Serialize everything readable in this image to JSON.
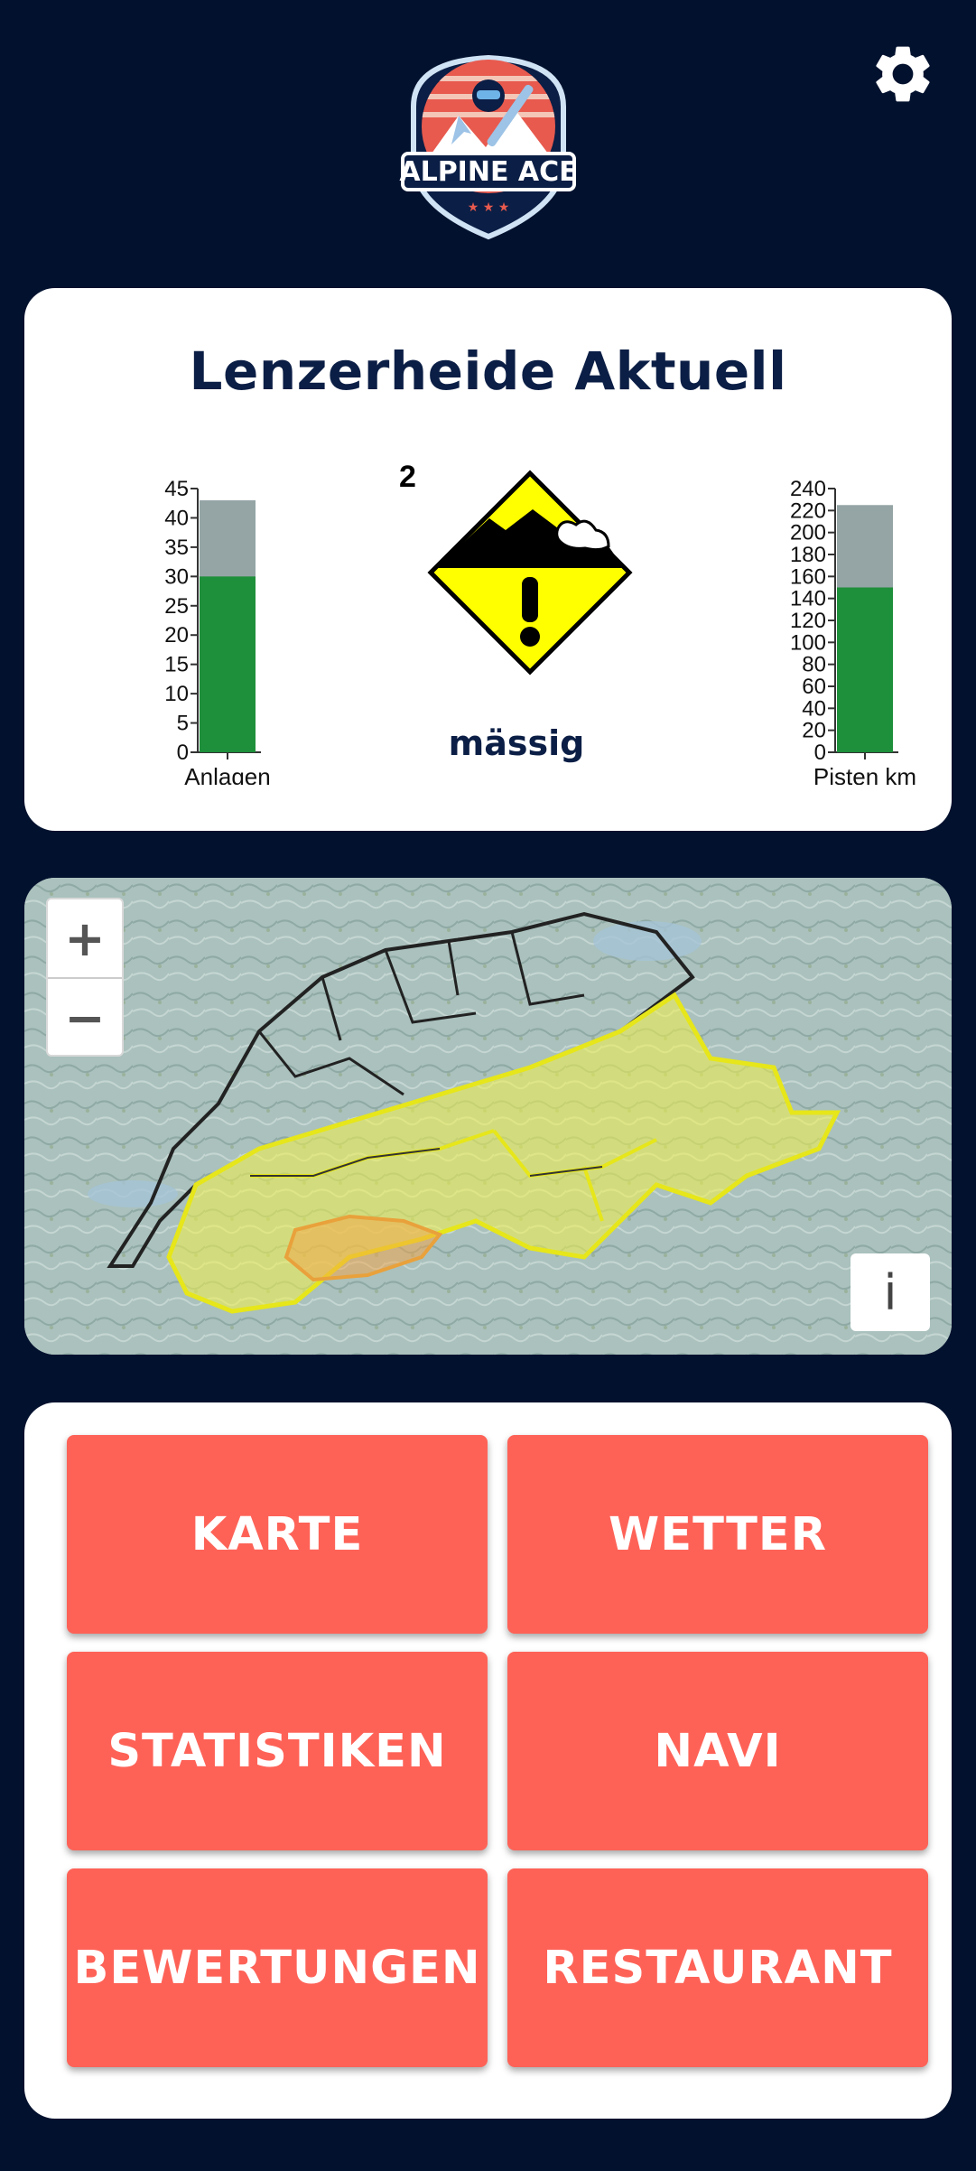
{
  "app": {
    "logo_text": "ALPINE ACE"
  },
  "header": {
    "settings_icon": "gear-icon"
  },
  "stats": {
    "title": "Lenzerheide Aktuell",
    "danger": {
      "level": "2",
      "label": "mässig",
      "icon": "avalanche-warning-icon"
    }
  },
  "chart_data": [
    {
      "type": "bar",
      "categories": [
        "Anlagen"
      ],
      "series": [
        {
          "values": [
            43
          ]
        },
        {
          "values": [
            30
          ]
        }
      ],
      "xlabel": "Anlagen",
      "ylim": [
        0,
        45
      ],
      "yticks": [
        0,
        5,
        10,
        15,
        20,
        25,
        30,
        35,
        40,
        45
      ],
      "colors": [
        "#95a5a6",
        "#1e8f3a"
      ]
    },
    {
      "type": "bar",
      "categories": [
        "Pisten km"
      ],
      "series": [
        {
          "values": [
            225
          ]
        },
        {
          "values": [
            150
          ]
        }
      ],
      "xlabel": "Pisten km",
      "ylim": [
        0,
        240
      ],
      "yticks": [
        0,
        20,
        40,
        60,
        80,
        100,
        120,
        140,
        160,
        180,
        200,
        220,
        240
      ],
      "colors": [
        "#95a5a6",
        "#1e8f3a"
      ]
    }
  ],
  "map": {
    "zoom_in": "+",
    "zoom_out": "−",
    "info": "i"
  },
  "menu": {
    "items": [
      {
        "label": "KARTE"
      },
      {
        "label": "WETTER"
      },
      {
        "label": "STATISTIKEN"
      },
      {
        "label": "NAVI"
      },
      {
        "label": "BEWERTUNGEN"
      },
      {
        "label": "RESTAURANT"
      }
    ]
  },
  "colors": {
    "background": "#02112e",
    "button": "#fe6257",
    "bar_open": "#1e8f3a",
    "bar_total": "#95a5a6",
    "danger_yellow": "#ffff00"
  }
}
